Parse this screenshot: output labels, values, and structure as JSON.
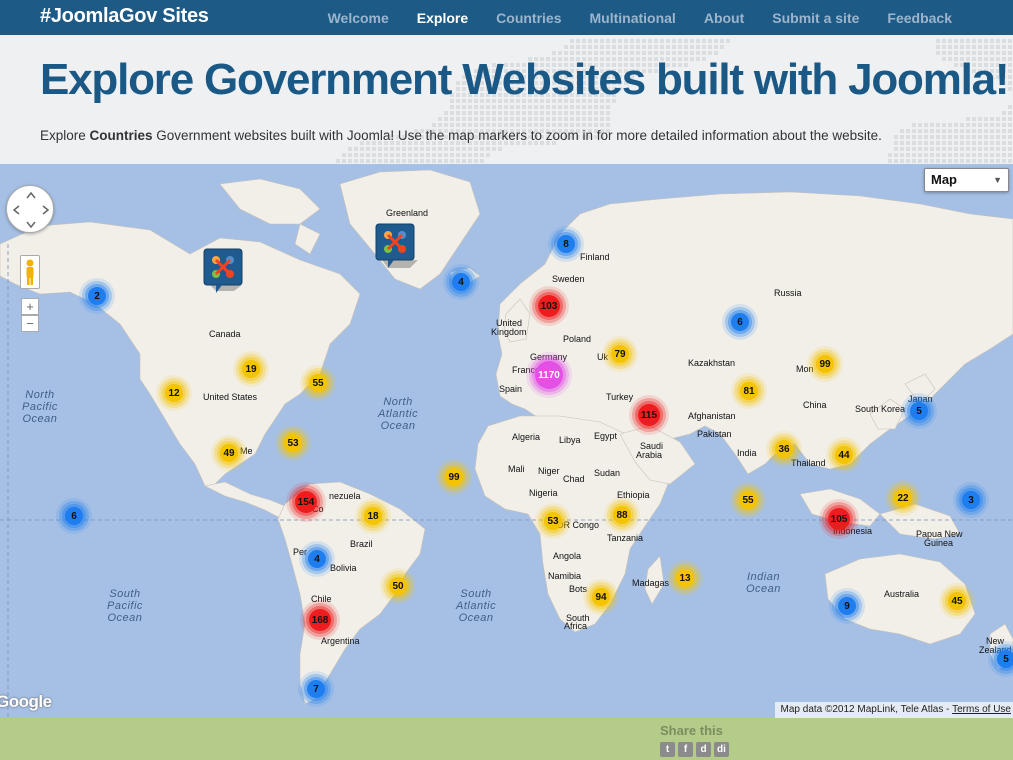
{
  "brand": "#JoomlaGov Sites",
  "nav": [
    {
      "label": "Welcome",
      "active": false
    },
    {
      "label": "Explore",
      "active": true
    },
    {
      "label": "Countries",
      "active": false
    },
    {
      "label": "Multinational",
      "active": false
    },
    {
      "label": "About",
      "active": false
    },
    {
      "label": "Submit a site",
      "active": false
    },
    {
      "label": "Feedback",
      "active": false
    }
  ],
  "header": {
    "title": "Explore Government Websites built with Joomla!",
    "intro_before": "Explore ",
    "intro_bold": "Countries",
    "intro_after": " Government websites built with Joomla! Use the map markers to zoom in for more detailed information about the website."
  },
  "map": {
    "type_selector": "Map",
    "zoom_in": "+",
    "zoom_out": "−",
    "google_logo": "Google",
    "attribution": "Map data ©2012 MapLink, Tele Atlas - ",
    "terms": "Terms of Use",
    "cluster_colors": {
      "blue": "#1e7ef0",
      "yellow": "#f5c400",
      "red": "#ee1c1c",
      "magenta": "#e44fe6"
    },
    "clusters": [
      {
        "id": "c-alaska",
        "count": "2",
        "color": "blue"
      },
      {
        "id": "c-iceland",
        "count": "4",
        "color": "blue"
      },
      {
        "id": "c-norway",
        "count": "8",
        "color": "blue"
      },
      {
        "id": "c-russia",
        "count": "6",
        "color": "blue"
      },
      {
        "id": "c-uk",
        "count": "103",
        "color": "red"
      },
      {
        "id": "c-ukraine",
        "count": "79",
        "color": "yellow"
      },
      {
        "id": "c-europe",
        "count": "1170",
        "color": "magenta"
      },
      {
        "id": "c-mongolia",
        "count": "99",
        "color": "yellow"
      },
      {
        "id": "c-west-us",
        "count": "12",
        "color": "yellow"
      },
      {
        "id": "c-canada",
        "count": "19",
        "color": "yellow"
      },
      {
        "id": "c-east-us",
        "count": "55",
        "color": "yellow"
      },
      {
        "id": "c-kazakh",
        "count": "81",
        "color": "yellow"
      },
      {
        "id": "c-turkey",
        "count": "115",
        "color": "red"
      },
      {
        "id": "c-japan",
        "count": "5",
        "color": "blue"
      },
      {
        "id": "c-gulf",
        "count": "53",
        "color": "yellow"
      },
      {
        "id": "c-mexico",
        "count": "49",
        "color": "yellow"
      },
      {
        "id": "c-india",
        "count": "36",
        "color": "yellow"
      },
      {
        "id": "c-seasia",
        "count": "44",
        "color": "yellow"
      },
      {
        "id": "c-atlantic",
        "count": "99",
        "color": "yellow"
      },
      {
        "id": "c-hawaii",
        "count": "6",
        "color": "blue"
      },
      {
        "id": "c-colombia",
        "count": "154",
        "color": "red"
      },
      {
        "id": "c-ind-ocean",
        "count": "55",
        "color": "yellow"
      },
      {
        "id": "c-png",
        "count": "22",
        "color": "yellow"
      },
      {
        "id": "c-pacific",
        "count": "3",
        "color": "blue"
      },
      {
        "id": "c-brazil",
        "count": "18",
        "color": "yellow"
      },
      {
        "id": "c-congo",
        "count": "53",
        "color": "yellow"
      },
      {
        "id": "c-tanzania",
        "count": "88",
        "color": "yellow"
      },
      {
        "id": "c-indonesia",
        "count": "105",
        "color": "red"
      },
      {
        "id": "c-peru",
        "count": "4",
        "color": "blue"
      },
      {
        "id": "c-madagascar",
        "count": "13",
        "color": "yellow"
      },
      {
        "id": "c-sbrazil",
        "count": "50",
        "color": "yellow"
      },
      {
        "id": "c-safrica",
        "count": "94",
        "color": "yellow"
      },
      {
        "id": "c-waus",
        "count": "9",
        "color": "blue"
      },
      {
        "id": "c-eaus",
        "count": "45",
        "color": "yellow"
      },
      {
        "id": "c-chile",
        "count": "168",
        "color": "red"
      },
      {
        "id": "c-nz",
        "count": "5",
        "color": "blue"
      },
      {
        "id": "c-patagonia",
        "count": "7",
        "color": "blue"
      }
    ],
    "labels": {
      "greenland": "Greenland",
      "finland": "Finland",
      "sweden": "Sweden",
      "russia": "Russia",
      "canada": "Canada",
      "united_kingdom_1": "United",
      "united_kingdom_2": "Kingdom",
      "poland": "Poland",
      "germany": "Germany",
      "france": "France",
      "uk_short": "Uk",
      "spain": "Spain",
      "kazakhstan": "Kazakhstan",
      "mongolia": "Mon",
      "united_states": "United States",
      "turkey": "Turkey",
      "afghanistan": "Afghanistan",
      "china": "China",
      "south_korea": "South Korea",
      "japan": "Japan",
      "pakistan": "Pakistan",
      "algeria": "Algeria",
      "libya": "Libya",
      "egypt": "Egypt",
      "saudi_1": "Saudi",
      "saudi_2": "Arabia",
      "india": "India",
      "thailand": "Thailand",
      "mali": "Mali",
      "niger": "Niger",
      "chad": "Chad",
      "sudan": "Sudan",
      "venezuela": "nezuela",
      "colombia": "Co",
      "nigeria": "Nigeria",
      "ethiopia": "Ethiopia",
      "dr_congo": "DR Congo",
      "tanzania": "Tanzania",
      "indonesia": "Indonesia",
      "papua_1": "Papua New",
      "papua_2": "Guinea",
      "peru": "Per",
      "brazil": "Brazil",
      "bolivia": "Bolivia",
      "angola": "Angola",
      "namibia": "Namibia",
      "botswana": "Bots",
      "madagascar": "Madagas",
      "south_africa_1": "South",
      "south_africa_2": "Africa",
      "chile": "Chile",
      "argentina": "Argentina",
      "australia": "Australia",
      "new_zealand_1": "New",
      "new_zealand_2": "Zealand",
      "mexico": "Me"
    },
    "oceans": {
      "north_pacific": "North\nPacific\nOcean",
      "north_atlantic": "North\nAtlantic\nOcean",
      "south_pacific": "South\nPacific\nOcean",
      "south_atlantic": "South\nAtlantic\nOcean",
      "indian": "Indian\nOcean"
    }
  },
  "footer": {
    "share_label": "Share this",
    "share_icons": [
      "twitter-icon",
      "facebook-icon",
      "delicious-icon",
      "digg-icon"
    ]
  }
}
